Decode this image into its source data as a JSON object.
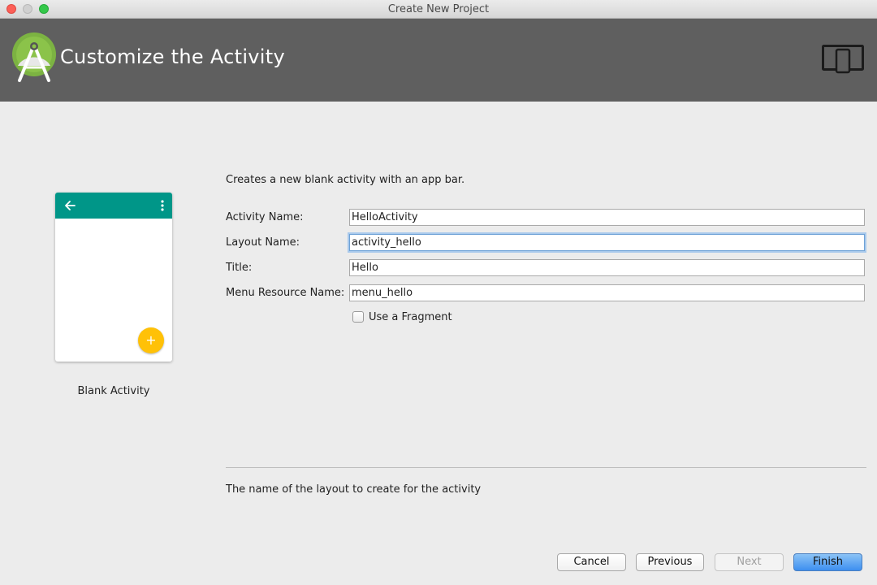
{
  "window": {
    "title": "Create New Project"
  },
  "banner": {
    "title": "Customize the Activity"
  },
  "template": {
    "name": "Blank Activity",
    "fab_symbol": "+"
  },
  "form": {
    "description": "Creates a new blank activity with an app bar.",
    "activity_name": {
      "label": "Activity Name:",
      "value": "HelloActivity"
    },
    "layout_name": {
      "label": "Layout Name:",
      "value": "activity_hello"
    },
    "title": {
      "label": "Title:",
      "value": "Hello"
    },
    "menu_resource_name": {
      "label": "Menu Resource Name:",
      "value": "menu_hello"
    },
    "use_fragment": {
      "label": "Use a Fragment",
      "checked": false
    }
  },
  "help": {
    "text": "The name of the layout to create for the activity"
  },
  "buttons": {
    "cancel": "Cancel",
    "previous": "Previous",
    "next": "Next",
    "finish": "Finish"
  },
  "colors": {
    "banner": "#5f5f5f",
    "app_bar": "#009688",
    "fab": "#ffc107",
    "android_green": "#a4c639",
    "focus": "#6fa2d6"
  }
}
